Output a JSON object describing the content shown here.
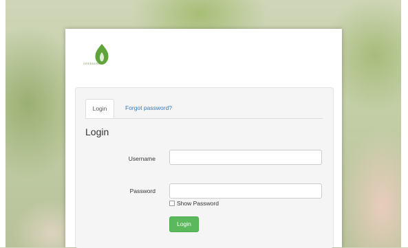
{
  "brand": {
    "logo_caption": "GREENERIA"
  },
  "tabs": {
    "login": "Login",
    "forgot": "Forgot password?"
  },
  "form": {
    "heading": "Login",
    "username_label": "Username",
    "username_value": "",
    "password_label": "Password",
    "password_value": "",
    "show_password_label": "Show Password",
    "submit_label": "Login"
  },
  "colors": {
    "primary_button": "#5cb85c",
    "link": "#337ab7",
    "logo": "#5fa33a"
  }
}
